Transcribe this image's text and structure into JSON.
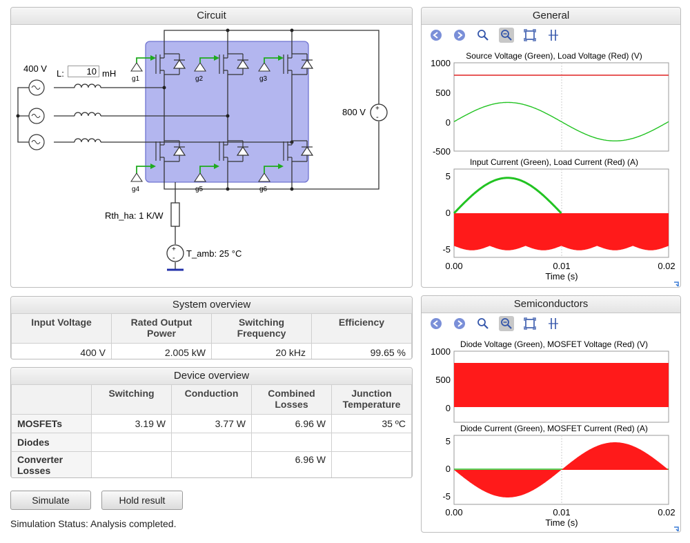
{
  "circuit": {
    "title": "Circuit",
    "source_voltage": "400 V",
    "inductance_label": "L:",
    "inductance_value": "10",
    "inductance_unit": "mH",
    "dc_voltage": "800 V",
    "gates": [
      "g1",
      "g2",
      "g3",
      "g4",
      "g5",
      "g6"
    ],
    "rth_label": "Rth_ha: 1 K/W",
    "tamb_label": "T_amb: 25 °C"
  },
  "general": {
    "title": "General",
    "plots": [
      {
        "title": "Source Voltage (Green), Load Voltage (Red) (V)",
        "yticks": [
          "1000",
          "500",
          "0",
          "-500"
        ],
        "ylim": [
          -500,
          1000
        ],
        "series": [
          {
            "name": "Source Voltage",
            "color": "#22c322",
            "kind": "sine",
            "amplitude": 327,
            "offset": 0,
            "periods": 1.0
          },
          {
            "name": "Load Voltage",
            "color": "#e02020",
            "kind": "const",
            "value": 800
          }
        ]
      },
      {
        "title": "Input Current (Green), Load Current (Red) (A)",
        "yticks": [
          "5",
          "0",
          "-5"
        ],
        "ylim": [
          -5,
          5
        ],
        "xticks": [
          "0.00",
          "0.01",
          "0.02"
        ],
        "xlabel": "Time (s)"
      }
    ]
  },
  "semis": {
    "title": "Semiconductors",
    "plots": [
      {
        "title": "Diode Voltage (Green), MOSFET Voltage (Red) (V)",
        "yticks": [
          "1000",
          "500",
          "0"
        ],
        "ylim": [
          -100,
          1000
        ]
      },
      {
        "title": "Diode Current (Green), MOSFET Current (Red) (A)",
        "yticks": [
          "5",
          "0",
          "-5"
        ],
        "ylim": [
          -5,
          5
        ],
        "xticks": [
          "0.00",
          "0.01",
          "0.02"
        ],
        "xlabel": "Time (s)"
      }
    ]
  },
  "system": {
    "title": "System overview",
    "headers": [
      "Input Voltage",
      "Rated Output Power",
      "Switching Frequency",
      "Efficiency"
    ],
    "values": [
      "400 V",
      "2.005 kW",
      "20 kHz",
      "99.65 %"
    ]
  },
  "device": {
    "title": "Device overview",
    "headers": [
      "",
      "Switching",
      "Conduction",
      "Combined Losses",
      "Junction Temperature"
    ],
    "rows": [
      {
        "label": "MOSFETs",
        "cells": [
          "3.19 W",
          "3.77 W",
          "6.96 W",
          "35 ºC"
        ]
      },
      {
        "label": "Diodes",
        "cells": [
          "",
          "",
          "",
          ""
        ]
      },
      {
        "label": "Converter Losses",
        "cells": [
          "",
          "",
          "6.96 W",
          ""
        ]
      }
    ]
  },
  "buttons": {
    "simulate": "Simulate",
    "hold": "Hold result"
  },
  "status": "Simulation Status: Analysis completed."
}
